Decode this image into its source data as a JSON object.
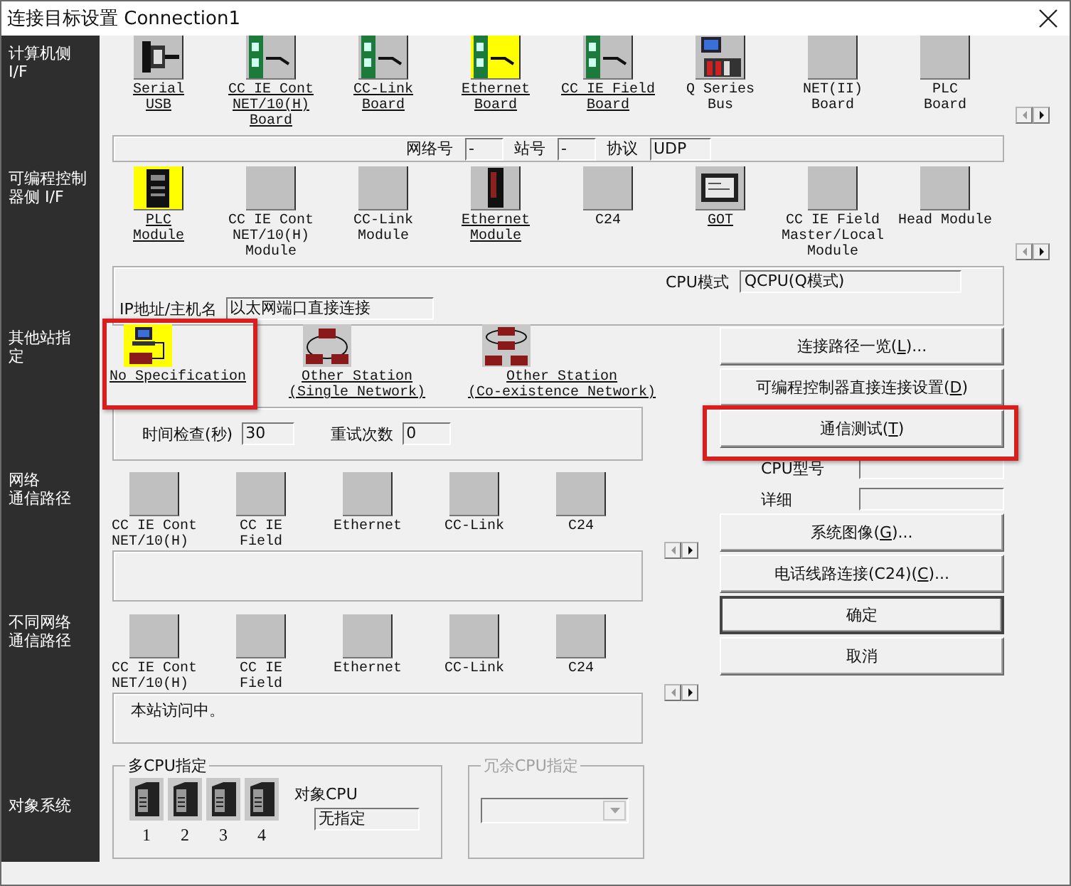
{
  "window": {
    "title": "连接目标设置 Connection1"
  },
  "pc_side": {
    "label": [
      "计算机侧",
      "I/F"
    ],
    "devices": [
      {
        "label": "Serial\nUSB",
        "kind": "serial",
        "enabled": true,
        "selected": false
      },
      {
        "label": "CC IE Cont\nNET/10(H)\nBoard",
        "kind": "board",
        "enabled": true,
        "selected": false
      },
      {
        "label": "CC-Link\nBoard",
        "kind": "board",
        "enabled": true,
        "selected": false
      },
      {
        "label": "Ethernet\nBoard",
        "kind": "board",
        "enabled": true,
        "selected": true
      },
      {
        "label": "CC IE Field\nBoard",
        "kind": "board",
        "enabled": true,
        "selected": false
      },
      {
        "label": "Q Series\nBus",
        "kind": "bus",
        "enabled": false,
        "selected": false
      },
      {
        "label": "NET(II)\nBoard",
        "kind": "blank",
        "enabled": false,
        "selected": false
      },
      {
        "label": "PLC\nBoard",
        "kind": "blank",
        "enabled": false,
        "selected": false
      }
    ],
    "network_label": "网络号",
    "network": "-",
    "station_label": "站号",
    "station": "-",
    "protocol_label": "协议",
    "protocol": "UDP"
  },
  "plc_side": {
    "label": [
      "可编程控制",
      "器侧 I/F"
    ],
    "devices": [
      {
        "label": "PLC\nModule",
        "kind": "cpu",
        "enabled": true,
        "selected": true
      },
      {
        "label": "CC IE Cont\nNET/10(H)\nModule",
        "kind": "blank",
        "enabled": false,
        "selected": false
      },
      {
        "label": "CC-Link\nModule",
        "kind": "blank",
        "enabled": false,
        "selected": false
      },
      {
        "label": "Ethernet\nModule",
        "kind": "module",
        "enabled": true,
        "selected": false
      },
      {
        "label": "C24",
        "kind": "blank",
        "enabled": false,
        "selected": false
      },
      {
        "label": "GOT",
        "kind": "panel",
        "enabled": true,
        "selected": false
      },
      {
        "label": "CC IE Field\nMaster/Local\nModule",
        "kind": "blank",
        "enabled": false,
        "selected": false
      },
      {
        "label": "Head Module",
        "kind": "blank",
        "enabled": false,
        "selected": false
      }
    ],
    "cpu_mode_label": "CPU模式",
    "cpu_mode": "QCPU(Q模式)",
    "ip_label": "IP地址/主机名",
    "ip": "以太网端口直接连接"
  },
  "other_station": {
    "label": [
      "其他站指",
      "定"
    ],
    "options": [
      {
        "label": "No Specification",
        "kind": "direct",
        "selected": true,
        "highlighted": true
      },
      {
        "label": "Other Station\n(Single Network)",
        "kind": "single",
        "selected": false,
        "highlighted": false
      },
      {
        "label": "Other Station\n(Co-existence Network)",
        "kind": "coexist",
        "selected": false,
        "highlighted": false
      }
    ],
    "time_check_label": "时间检查(秒)",
    "time_check": "30",
    "retry_label": "重试次数",
    "retry": "0"
  },
  "network_route": {
    "label": [
      "网络",
      "通信路径"
    ],
    "devices": [
      {
        "label": "CC IE Cont\nNET/10(H)",
        "enabled": false,
        "selected": false
      },
      {
        "label": "CC IE\nField",
        "enabled": false,
        "selected": false
      },
      {
        "label": "Ethernet",
        "enabled": false,
        "selected": false
      },
      {
        "label": "CC-Link",
        "enabled": false,
        "selected": false
      },
      {
        "label": "C24",
        "enabled": false,
        "selected": false
      }
    ]
  },
  "diff_network_route": {
    "label": [
      "不同网络",
      "通信路径"
    ],
    "devices": [
      {
        "label": "CC IE Cont\nNET/10(H)",
        "enabled": false,
        "selected": false
      },
      {
        "label": "CC IE\nField",
        "enabled": false,
        "selected": false
      },
      {
        "label": "Ethernet",
        "enabled": false,
        "selected": false
      },
      {
        "label": "CC-Link",
        "enabled": false,
        "selected": false
      },
      {
        "label": "C24",
        "enabled": false,
        "selected": false
      }
    ],
    "message": "本站访问中。"
  },
  "target_system": {
    "label": [
      "对象系统"
    ],
    "multi_cpu": {
      "title": "多CPU指定",
      "cpus": [
        {
          "number": "1"
        },
        {
          "number": "2"
        },
        {
          "number": "3"
        },
        {
          "number": "4"
        }
      ],
      "target_label": "对象CPU",
      "target": "无指定"
    },
    "redundant": {
      "title": "冗余CPU指定",
      "disabled": true
    }
  },
  "actions": [
    {
      "kind": "button",
      "pre": "连接路径一览(",
      "key": "L",
      "post": ")...",
      "highlighted": false,
      "default": false
    },
    {
      "kind": "button",
      "pre": "可编程控制器直接连接设置(",
      "key": "D",
      "post": ")",
      "highlighted": false,
      "default": false
    },
    {
      "kind": "button",
      "pre": "通信测试(",
      "key": "T",
      "post": ")",
      "highlighted": true,
      "default": false
    },
    {
      "kind": "field",
      "label": "CPU型号"
    },
    {
      "kind": "field",
      "label": "详细"
    },
    {
      "kind": "button",
      "pre": "系统图像(",
      "key": "G",
      "post": ")...",
      "highlighted": false,
      "default": false
    },
    {
      "kind": "button",
      "pre": "电话线路连接(C24)(",
      "key": "C",
      "post": ")...",
      "highlighted": false,
      "default": false
    },
    {
      "kind": "button",
      "pre": "确定",
      "highlighted": false,
      "default": true
    },
    {
      "kind": "button",
      "pre": "取消",
      "highlighted": false,
      "default": false
    }
  ]
}
